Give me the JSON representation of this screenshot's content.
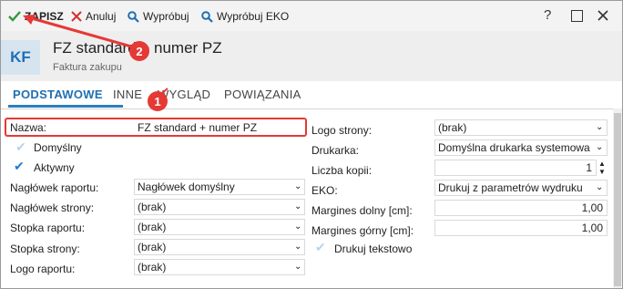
{
  "toolbar": {
    "save_label": "ZAPISZ",
    "cancel_label": "Anuluj",
    "test_label": "Wypróbuj",
    "test_eko_label": "Wypróbuj EKO",
    "help_label": "?"
  },
  "header": {
    "badge": "KF",
    "title": "FZ standard + numer PZ",
    "subtitle": "Faktura zakupu"
  },
  "tabs": [
    "PODSTAWOWE",
    "INNE",
    "WYGLĄD",
    "POWIĄZANIA"
  ],
  "annotations": {
    "badge1": "1",
    "badge2": "2",
    "color": "#e53935"
  },
  "left": {
    "name_label": "Nazwa:",
    "name_value": "FZ standard + numer PZ",
    "default_label": "Domyślny",
    "default_checked": false,
    "active_label": "Aktywny",
    "active_checked": true,
    "report_header_label": "Nagłówek raportu:",
    "report_header_value": "Nagłówek domyślny",
    "page_header_label": "Nagłówek strony:",
    "page_header_value": "(brak)",
    "report_footer_label": "Stopka raportu:",
    "report_footer_value": "(brak)",
    "page_footer_label": "Stopka strony:",
    "page_footer_value": "(brak)",
    "report_logo_label": "Logo raportu:",
    "report_logo_value": "(brak)"
  },
  "right": {
    "page_logo_label": "Logo strony:",
    "page_logo_value": "(brak)",
    "printer_label": "Drukarka:",
    "printer_value": "Domyślna drukarka systemowa",
    "copies_label": "Liczba kopii:",
    "copies_value": "1",
    "eko_label": "EKO:",
    "eko_value": "Drukuj z parametrów wydruku",
    "margin_bottom_label": "Margines dolny [cm]:",
    "margin_bottom_value": "1,00",
    "margin_top_label": "Margines górny [cm]:",
    "margin_top_value": "1,00",
    "text_print_label": "Drukuj tekstowo",
    "text_print_checked": false
  }
}
